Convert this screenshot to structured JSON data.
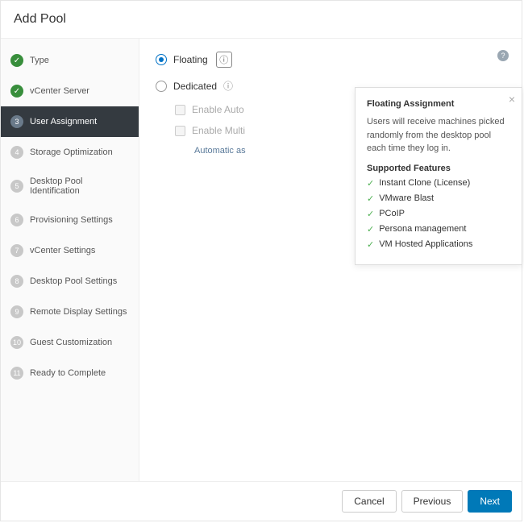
{
  "header": {
    "title": "Add Pool"
  },
  "steps": [
    {
      "label": "Type",
      "state": "done",
      "num": ""
    },
    {
      "label": "vCenter Server",
      "state": "done",
      "num": ""
    },
    {
      "label": "User Assignment",
      "state": "current",
      "num": "3"
    },
    {
      "label": "Storage Optimization",
      "state": "todo",
      "num": "4"
    },
    {
      "label": "Desktop Pool Identification",
      "state": "todo",
      "num": "5"
    },
    {
      "label": "Provisioning Settings",
      "state": "todo",
      "num": "6"
    },
    {
      "label": "vCenter Settings",
      "state": "todo",
      "num": "7"
    },
    {
      "label": "Desktop Pool Settings",
      "state": "todo",
      "num": "8"
    },
    {
      "label": "Remote Display Settings",
      "state": "todo",
      "num": "9"
    },
    {
      "label": "Guest Customization",
      "state": "todo",
      "num": "10"
    },
    {
      "label": "Ready to Complete",
      "state": "todo",
      "num": "11"
    }
  ],
  "options": {
    "floating": "Floating",
    "dedicated": "Dedicated",
    "enableAuto": "Enable Auto",
    "enableMulti": "Enable Multi",
    "autoNote": "Automatic as"
  },
  "popover": {
    "title": "Floating Assignment",
    "description": "Users will receive machines picked randomly from the desktop pool each time they log in.",
    "supportedLabel": "Supported Features",
    "features": [
      "Instant Clone (License)",
      "VMware Blast",
      "PCoIP",
      "Persona management",
      "VM Hosted Applications"
    ]
  },
  "footer": {
    "cancel": "Cancel",
    "previous": "Previous",
    "next": "Next"
  }
}
